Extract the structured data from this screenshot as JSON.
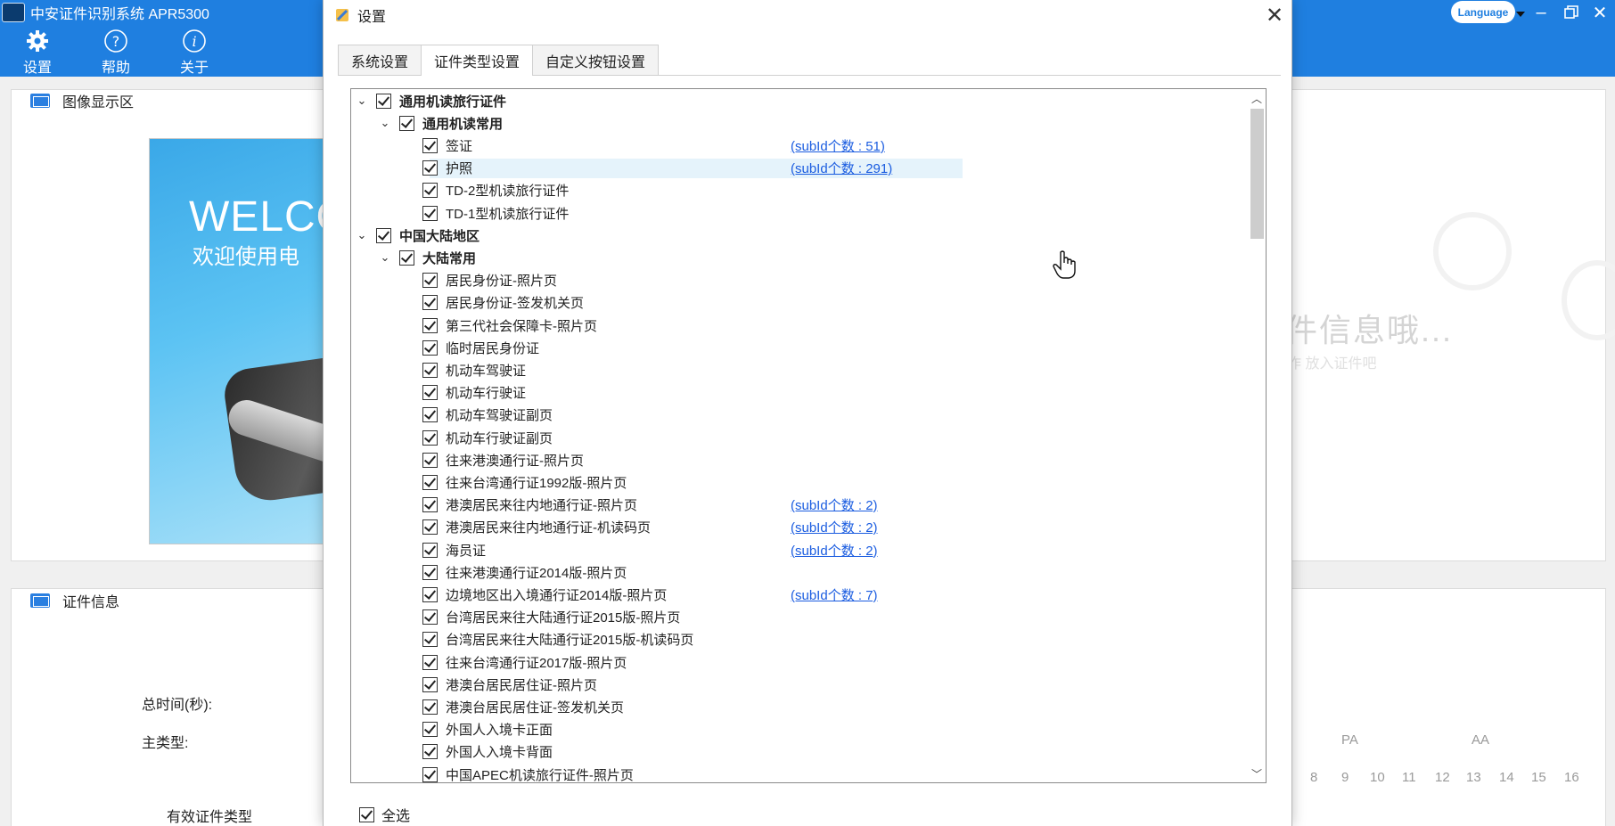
{
  "app": {
    "title": "中安证件识别系统 APR5300",
    "language_label": "Language",
    "toolbar": [
      {
        "label": "设置",
        "icon": "gear-icon"
      },
      {
        "label": "帮助",
        "icon": "help-icon"
      },
      {
        "label": "关于",
        "icon": "info-icon"
      }
    ],
    "image_panel_title": "图像显示区",
    "welcome_big": "WELCO",
    "welcome_sub": "欢迎使用电",
    "hint_main": "件信息哦...",
    "hint_sub": "作 放入证件吧",
    "info_panel_title": "证件信息",
    "total_time_label": "总时间(秒):",
    "main_type_label": "主类型:",
    "valid_type_label": "有效证件类型",
    "right_labels": [
      "PA",
      "AA"
    ],
    "right_numbers": [
      "8",
      "9",
      "10",
      "11",
      "12",
      "13",
      "14",
      "15",
      "16"
    ]
  },
  "dialog": {
    "title": "设置",
    "tabs": [
      "系统设置",
      "证件类型设置",
      "自定义按钮设置"
    ],
    "active_tab": 1,
    "select_all_label": "全选",
    "tree": [
      {
        "level": 0,
        "label": "通用机读旅行证件",
        "bold": true,
        "expandable": true
      },
      {
        "level": 1,
        "label": "通用机读常用",
        "bold": true,
        "expandable": true
      },
      {
        "level": 2,
        "label": "签证",
        "sub": "(subId个数 : 51)"
      },
      {
        "level": 2,
        "label": "护照",
        "sub": "(subId个数 : 291)",
        "selected": true
      },
      {
        "level": 2,
        "label": "TD-2型机读旅行证件"
      },
      {
        "level": 2,
        "label": "TD-1型机读旅行证件"
      },
      {
        "level": 0,
        "label": "中国大陆地区",
        "bold": true,
        "expandable": true
      },
      {
        "level": 1,
        "label": "大陆常用",
        "bold": true,
        "expandable": true
      },
      {
        "level": 2,
        "label": "居民身份证-照片页"
      },
      {
        "level": 2,
        "label": "居民身份证-签发机关页"
      },
      {
        "level": 2,
        "label": "第三代社会保障卡-照片页"
      },
      {
        "level": 2,
        "label": "临时居民身份证"
      },
      {
        "level": 2,
        "label": "机动车驾驶证"
      },
      {
        "level": 2,
        "label": "机动车行驶证"
      },
      {
        "level": 2,
        "label": "机动车驾驶证副页"
      },
      {
        "level": 2,
        "label": "机动车行驶证副页"
      },
      {
        "level": 2,
        "label": "往来港澳通行证-照片页"
      },
      {
        "level": 2,
        "label": "往来台湾通行证1992版-照片页"
      },
      {
        "level": 2,
        "label": "港澳居民来往内地通行证-照片页",
        "sub": "(subId个数 : 2)"
      },
      {
        "level": 2,
        "label": "港澳居民来往内地通行证-机读码页",
        "sub": "(subId个数 : 2)"
      },
      {
        "level": 2,
        "label": "海员证",
        "sub": "(subId个数 : 2)"
      },
      {
        "level": 2,
        "label": "往来港澳通行证2014版-照片页"
      },
      {
        "level": 2,
        "label": "边境地区出入境通行证2014版-照片页",
        "sub": "(subId个数 : 7)"
      },
      {
        "level": 2,
        "label": "台湾居民来往大陆通行证2015版-照片页"
      },
      {
        "level": 2,
        "label": "台湾居民来往大陆通行证2015版-机读码页"
      },
      {
        "level": 2,
        "label": "往来台湾通行证2017版-照片页"
      },
      {
        "level": 2,
        "label": "港澳台居民居住证-照片页"
      },
      {
        "level": 2,
        "label": "港澳台居民居住证-签发机关页"
      },
      {
        "level": 2,
        "label": "外国人入境卡正面"
      },
      {
        "level": 2,
        "label": "外国人入境卡背面"
      },
      {
        "level": 2,
        "label": "中国APEC机读旅行证件-照片页"
      }
    ]
  },
  "colors": {
    "accent": "#1f7fe0",
    "link": "#1a5ce0",
    "selection": "#e5f3fb"
  }
}
